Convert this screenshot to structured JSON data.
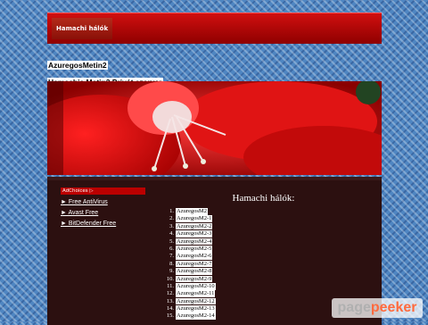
{
  "topnav": {
    "label": "Hamachi hálók"
  },
  "site": {
    "title": "AzuregosMetin2",
    "subtitle": "Hamachis Metin2 Privát szerver"
  },
  "sidebar": {
    "adchoices": "AdChoices ▷",
    "links": [
      {
        "label": "► Free AntiVirus"
      },
      {
        "label": "► Avast Free"
      },
      {
        "label": "► BitDefender Free"
      }
    ]
  },
  "content": {
    "title": "Hamachi hálók:",
    "items": [
      {
        "num": "1.",
        "label": "AzuregosM2"
      },
      {
        "num": "2.",
        "label": "AzuregosM2-1"
      },
      {
        "num": "3.",
        "label": "AzuregosM2-2"
      },
      {
        "num": "4.",
        "label": "AzuregosM2-3"
      },
      {
        "num": "5.",
        "label": "AzuregosM2-4"
      },
      {
        "num": "6.",
        "label": "AzuregosM2-5"
      },
      {
        "num": "7.",
        "label": "AzuregosM2-6"
      },
      {
        "num": "8.",
        "label": "AzuregosM2-7"
      },
      {
        "num": "9.",
        "label": "AzuregosM2-8"
      },
      {
        "num": "10.",
        "label": "AzuregosM2-9"
      },
      {
        "num": "11.",
        "label": "AzuregosM2-10"
      },
      {
        "num": "12.",
        "label": "AzuregosM2-11"
      },
      {
        "num": "13.",
        "label": "AzuregosM2-12"
      },
      {
        "num": "14.",
        "label": "AzuregosM2-13"
      },
      {
        "num": "15.",
        "label": "AzuregosM2-14"
      }
    ]
  },
  "watermark": {
    "part1": "page",
    "part2": "peeker"
  },
  "colors": {
    "accent": "#cc0000",
    "content_bg": "#2c1010",
    "background": "#4f86c2"
  }
}
